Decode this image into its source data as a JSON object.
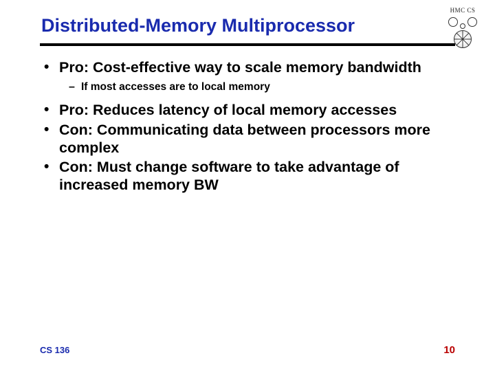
{
  "title": "Distributed-Memory Multiprocessor",
  "logo_text": "HMC CS",
  "bullets": [
    {
      "text": "Pro: Cost-effective way to scale memory bandwidth",
      "sub": [
        "If most accesses are to local memory"
      ]
    },
    {
      "text": "Pro: Reduces latency of local memory accesses"
    },
    {
      "text": "Con:  Communicating data between processors more complex"
    },
    {
      "text": "Con: Must change software to take advantage of increased memory BW"
    }
  ],
  "footer": {
    "course": "CS 136",
    "page": "10"
  },
  "colors": {
    "title": "#1a2bae",
    "rule": "#000000",
    "pagenum": "#b90000"
  }
}
